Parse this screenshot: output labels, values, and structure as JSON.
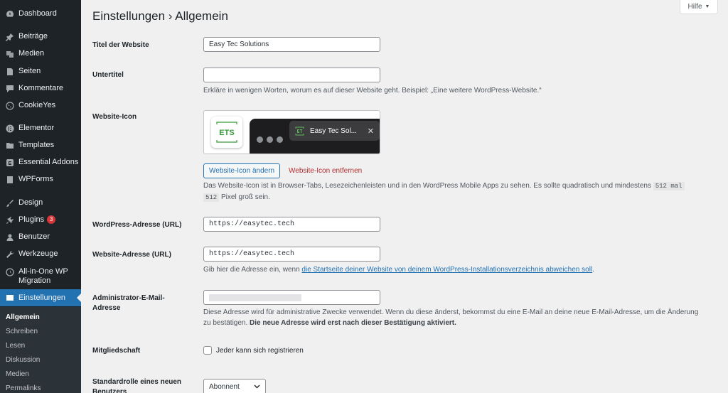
{
  "sidebar": {
    "items": [
      {
        "key": "dashboard",
        "label": "Dashboard",
        "icon": "dashboard-icon"
      },
      {
        "key": "posts",
        "label": "Beiträge",
        "icon": "pin-icon"
      },
      {
        "key": "media",
        "label": "Medien",
        "icon": "media-icon"
      },
      {
        "key": "pages",
        "label": "Seiten",
        "icon": "page-icon"
      },
      {
        "key": "comments",
        "label": "Kommentare",
        "icon": "comment-icon"
      },
      {
        "key": "cookieyes",
        "label": "CookieYes",
        "icon": "cookie-icon"
      },
      {
        "key": "elementor",
        "label": "Elementor",
        "icon": "elementor-icon"
      },
      {
        "key": "templates",
        "label": "Templates",
        "icon": "folder-icon"
      },
      {
        "key": "essential-addons",
        "label": "Essential Addons",
        "icon": "addons-icon"
      },
      {
        "key": "wpforms",
        "label": "WPForms",
        "icon": "forms-icon"
      },
      {
        "key": "design",
        "label": "Design",
        "icon": "brush-icon"
      },
      {
        "key": "plugins",
        "label": "Plugins",
        "icon": "plugin-icon",
        "badge": "3"
      },
      {
        "key": "users",
        "label": "Benutzer",
        "icon": "user-icon"
      },
      {
        "key": "tools",
        "label": "Werkzeuge",
        "icon": "wrench-icon"
      },
      {
        "key": "migration",
        "label": "All-in-One WP Migration",
        "icon": "migration-icon"
      },
      {
        "key": "settings",
        "label": "Einstellungen",
        "icon": "settings-icon"
      }
    ],
    "submenu": [
      {
        "label": "Allgemein",
        "current": true
      },
      {
        "label": "Schreiben"
      },
      {
        "label": "Lesen"
      },
      {
        "label": "Diskussion"
      },
      {
        "label": "Medien"
      },
      {
        "label": "Permalinks"
      }
    ],
    "badge_color": "#d63638",
    "active_color": "#2271b1"
  },
  "header": {
    "title": "Einstellungen › Allgemein",
    "help_label": "Hilfe"
  },
  "form": {
    "site_title": {
      "label": "Titel der Website",
      "value": "Easy Tec Solutions"
    },
    "tagline": {
      "label": "Untertitel",
      "value": "",
      "description": "Erkläre in wenigen Worten, worum es auf dieser Website geht. Beispiel: „Eine weitere WordPress-Website.“"
    },
    "site_icon": {
      "label": "Website-Icon",
      "logo_text": "ETS",
      "tab_title": "Easy Tec Sol...",
      "tab_close": "✕",
      "change_label": "Website-Icon ändern",
      "remove_label": "Website-Icon entfernen",
      "description_part1": "Das Website-Icon ist in Browser-Tabs, Lesezeichenleisten und in den WordPress Mobile Apps zu sehen. Es sollte quadratisch und mindestens",
      "description_code1": "512 mal",
      "description_code2": "512",
      "description_part2": "Pixel groß sein."
    },
    "wp_address": {
      "label": "WordPress-Adresse (URL)",
      "value": "https://easytec.tech"
    },
    "site_address": {
      "label": "Website-Adresse (URL)",
      "value": "https://easytec.tech",
      "description_before": "Gib hier die Adresse ein, wenn",
      "description_link": "die Startseite deiner Website von deinem WordPress-Installationsverzeichnis abweichen soll",
      "description_after": "."
    },
    "admin_email": {
      "label": "Administrator-E-Mail-Adresse",
      "description": "Diese Adresse wird für administrative Zwecke verwendet. Wenn du diese änderst, bekommst du eine E-Mail an deine neue E-Mail-Adresse, um die Änderung zu bestätigen.",
      "description_bold": "Die neue Adresse wird erst nach dieser Bestätigung aktiviert."
    },
    "membership": {
      "label": "Mitgliedschaft",
      "checkbox_label": "Jeder kann sich registrieren"
    },
    "default_role": {
      "label": "Standardrolle eines neuen Benutzers",
      "value": "Abonnent"
    }
  }
}
